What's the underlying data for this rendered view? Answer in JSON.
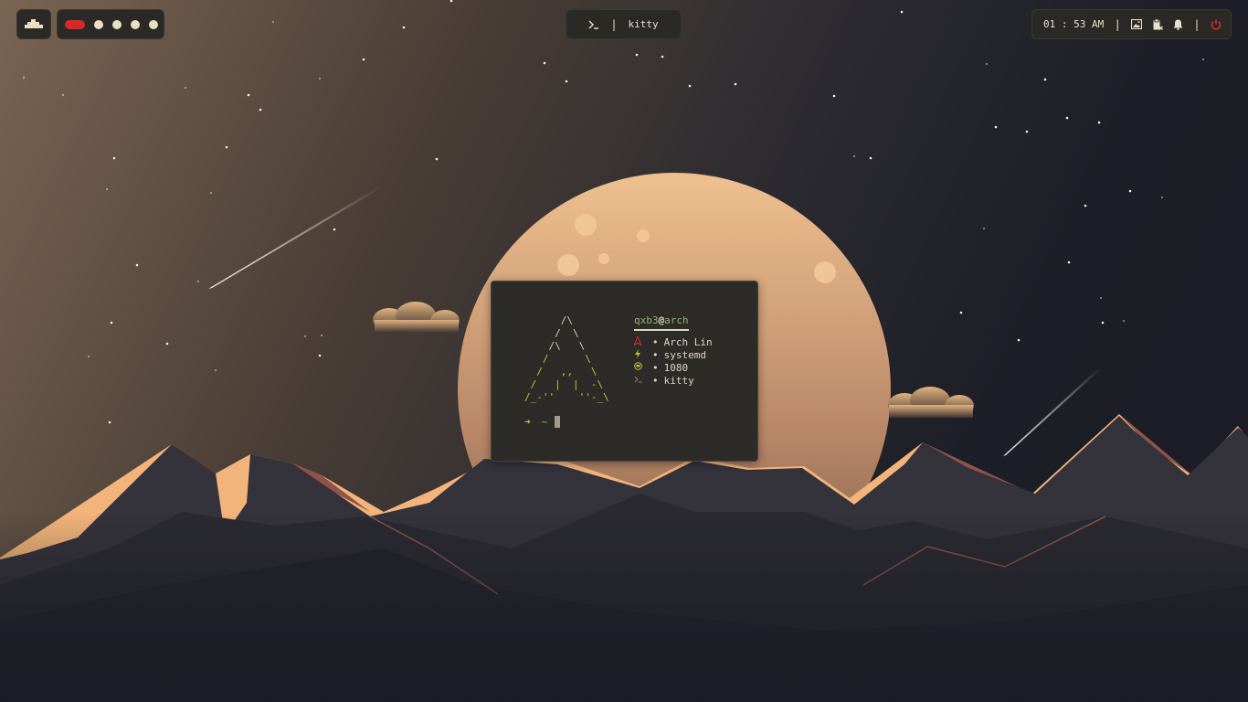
{
  "topbar": {
    "launcher": {
      "icon": "ship-icon"
    },
    "workspaces": [
      {
        "index": 1,
        "active": true
      },
      {
        "index": 2,
        "active": false
      },
      {
        "index": 3,
        "active": false
      },
      {
        "index": 4,
        "active": false
      },
      {
        "index": 5,
        "active": false
      }
    ],
    "window": {
      "icon": "terminal-icon",
      "separator": "|",
      "title": "kitty"
    },
    "status": {
      "clock": "01 : 53 AM",
      "separator": "|",
      "icons": [
        "screenshot-icon",
        "clipboard-icon",
        "bell-icon",
        "power-icon"
      ],
      "power_color": "#d62a2a"
    }
  },
  "terminal": {
    "ascii_top": "      /\\\n     /  \\\n    /\\   \\",
    "ascii_bottom": "   /      \\\n  /   ,,   \\\n /   |  |  -\\\n/_-''    ''-_\\",
    "user": "qxb3",
    "at": "@",
    "host": "arch",
    "info": [
      {
        "icon": "arch-icon",
        "icon_color": "#d62a2a",
        "bullet": "•",
        "value": "Arch Lin"
      },
      {
        "icon": "flash-icon",
        "icon_color": "#c8c23a",
        "bullet": "•",
        "value": "systemd"
      },
      {
        "icon": "monitor-icon",
        "icon_color": "#c8c23a",
        "bullet": "•",
        "value": "1080"
      },
      {
        "icon": "prompt-icon",
        "icon_color": "#c06a6a",
        "bullet": "•",
        "value": "kitty"
      }
    ],
    "prompt": {
      "arrow": "➜",
      "dir": "~"
    }
  },
  "colors": {
    "bar_bg": "#2a2926",
    "fg": "#e8e0cc",
    "accent_red": "#d62a2a",
    "green": "#8fb573",
    "yellow": "#c8c23a",
    "moon": "#e8b98a",
    "peak": "#f0b47a"
  }
}
